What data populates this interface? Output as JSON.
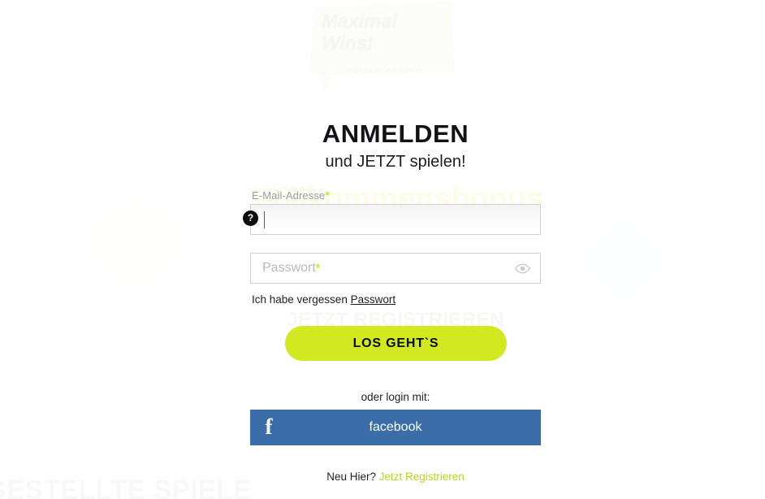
{
  "brand": {
    "logo_line1": "Maximal",
    "logo_line2": "Wins!",
    "logo_tagline": "online casino",
    "accent_green": "#d2e820",
    "link_green": "#bcd41e",
    "facebook_blue": "#3b6ea8",
    "text_dark": "#111318"
  },
  "background": {
    "behind_heading": "GESTELLTE SPIELE",
    "behind_corner_letter": "A",
    "ghost_word_behind_form": "Willkommensbonus",
    "ghost_word_behind_button": "JETZT REGISTRIEREN"
  },
  "modal": {
    "title": "ANMELDEN",
    "subtitle": "und JETZT spielen!",
    "email": {
      "label": "E-Mail-Adresse",
      "required_marker": "*",
      "value": "",
      "placeholder": "",
      "focused": true,
      "help_badge": "?"
    },
    "password": {
      "label": "Passwort",
      "required_marker": "*",
      "value": "",
      "placeholder": "Passwort",
      "toggle_icon": "eye-icon"
    },
    "forgot": {
      "prefix": "Ich habe vergessen",
      "link": "Passwort"
    },
    "submit_label": "LOS GEHT`S",
    "social": {
      "label": "oder login mit:",
      "facebook_icon": "f",
      "facebook_label": "facebook"
    },
    "footer": {
      "prefix": "Neu Hier?",
      "link": "Jetzt Registrieren"
    }
  }
}
